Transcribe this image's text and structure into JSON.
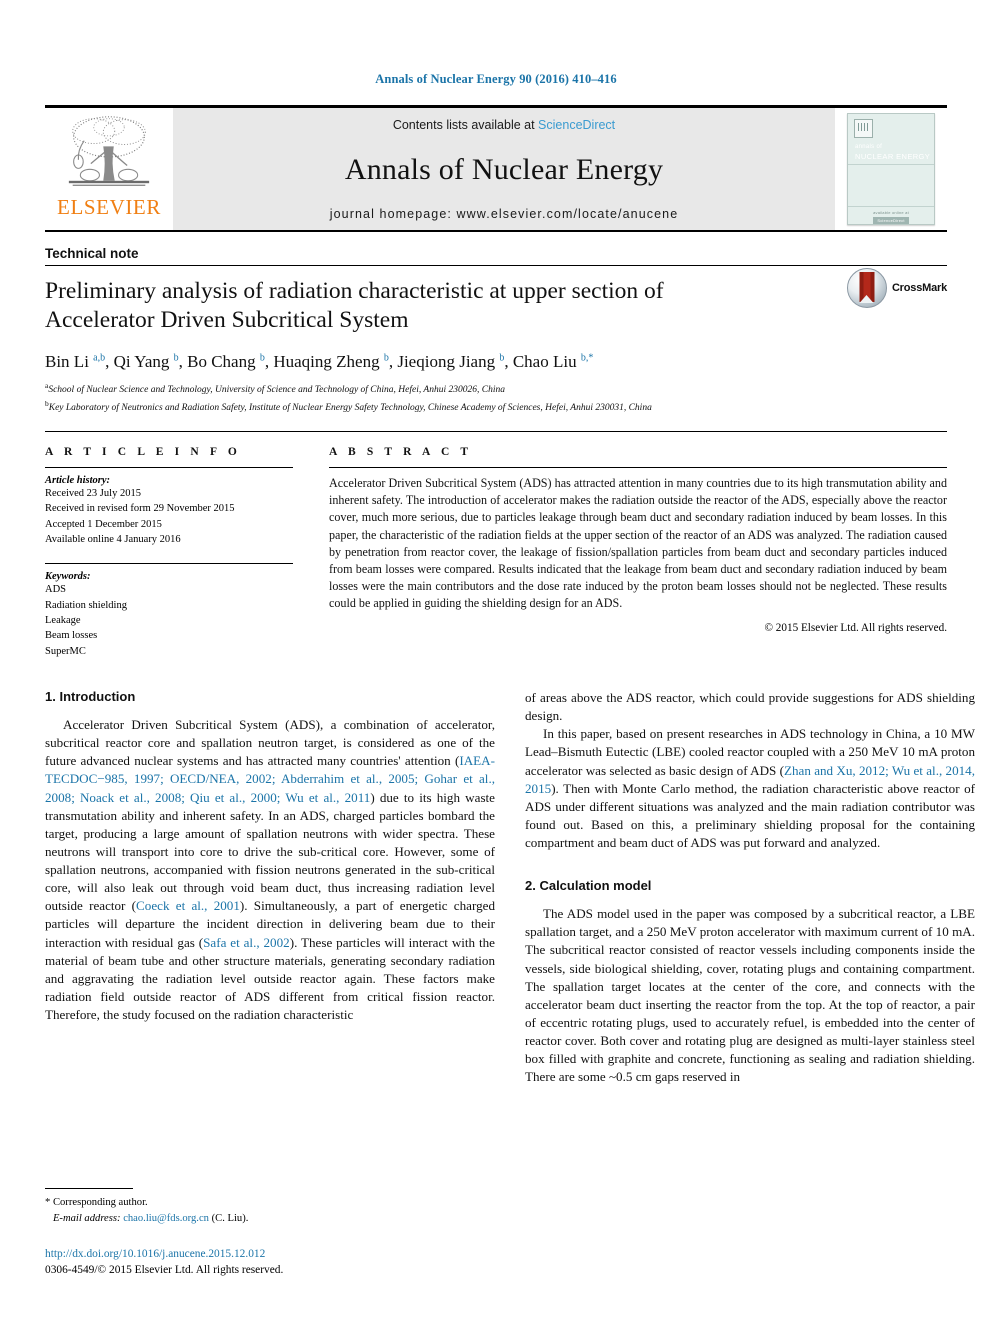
{
  "running_head": "Annals of Nuclear Energy 90 (2016) 410–416",
  "masthead": {
    "publisher": "ELSEVIER",
    "contents_prefix": "Contents lists available at ",
    "contents_link": "ScienceDirect",
    "journal_title": "Annals of Nuclear Energy",
    "homepage": "journal homepage: www.elsevier.com/locate/anucene",
    "cover": {
      "line1": "annals of",
      "line2": "NUCLEAR ENERGY",
      "footer_text": "available online at",
      "footer_badge": "ScienceDirect"
    }
  },
  "article": {
    "type": "Technical note",
    "title": "Preliminary analysis of radiation characteristic at upper section of Accelerator Driven Subcritical System",
    "crossmark_label": "CrossMark",
    "authors_html": "Bin Li <sup>a,b</sup>, Qi Yang <sup>b</sup>, Bo Chang <sup>b</sup>, Huaqing Zheng <sup>b</sup>, Jieqiong Jiang <sup>b</sup>, Chao Liu <sup class=\"star\">b,*</sup>",
    "affiliations": [
      "a School of Nuclear Science and Technology, University of Science and Technology of China, Hefei, Anhui 230026, China",
      "b Key Laboratory of Neutronics and Radiation Safety, Institute of Nuclear Energy Safety Technology, Chinese Academy of Sciences, Hefei, Anhui 230031, China"
    ]
  },
  "article_info": {
    "heading": "A R T I C L E   I N F O",
    "history_title": "Article history:",
    "history": [
      "Received 23 July 2015",
      "Received in revised form 29 November 2015",
      "Accepted 1 December 2015",
      "Available online 4 January 2016"
    ],
    "keywords_title": "Keywords:",
    "keywords": [
      "ADS",
      "Radiation shielding",
      "Leakage",
      "Beam losses",
      "SuperMC"
    ]
  },
  "abstract": {
    "heading": "A B S T R A C T",
    "text": "Accelerator Driven Subcritical System (ADS) has attracted attention in many countries due to its high transmutation ability and inherent safety. The introduction of accelerator makes the radiation outside the reactor of the ADS, especially above the reactor cover, much more serious, due to particles leakage through beam duct and secondary radiation induced by beam losses. In this paper, the characteristic of the radiation fields at the upper section of the reactor of an ADS was analyzed. The radiation caused by penetration from reactor cover, the leakage of fission/spallation particles from beam duct and secondary particles induced from beam losses were compared. Results indicated that the leakage from beam duct and secondary radiation induced by beam losses were the main contributors and the dose rate induced by the proton beam losses should not be neglected. These results could be applied in guiding the shielding design for an ADS.",
    "copyright": "© 2015 Elsevier Ltd. All rights reserved."
  },
  "sections": {
    "intro_heading": "1. Introduction",
    "intro_p1_a": "Accelerator Driven Subcritical System (ADS), a combination of accelerator, subcritical reactor core and spallation neutron target, is considered as one of the future advanced nuclear systems and has attracted many countries' attention (",
    "intro_p1_cite1": "IAEA-TECDOC−985, 1997; OECD/NEA, 2002; Abderrahim et al., 2005; Gohar et al., 2008; Noack et al., 2008; Qiu et al., 2000; Wu et al., 2011",
    "intro_p1_b": ") due to its high waste transmutation ability and inherent safety. In an ADS, charged particles bombard the target, producing a large amount of spallation neutrons with wider spectra. These neutrons will transport into core to drive the sub-critical core. However, some of spallation neutrons, accompanied with fission neutrons generated in the sub-critical core, will also leak out through void beam duct, thus increasing radiation level outside reactor (",
    "intro_p1_cite2": "Coeck et al., 2001",
    "intro_p1_c": "). Simultaneously, a part of energetic charged particles will departure the incident direction in delivering beam due to their interaction with residual gas (",
    "intro_p1_cite3": "Safa et al., 2002",
    "intro_p1_d": "). These particles will interact with the material of beam tube and other structure materials, generating secondary radiation and aggravating the radiation level outside reactor again. These factors make radiation field outside reactor of ADS different from critical fission reactor. Therefore, the study focused on the radiation characteristic of areas above the ADS reactor, which could provide suggestions for ADS shielding design.",
    "intro_p2_a": "In this paper, based on present researches in ADS technology in China, a 10 MW Lead–Bismuth Eutectic (LBE) cooled reactor coupled with a 250 MeV 10 mA proton accelerator was selected as basic design of ADS (",
    "intro_p2_cite": "Zhan and Xu, 2012; Wu et al., 2014, 2015",
    "intro_p2_b": "). Then with Monte Carlo method, the radiation characteristic above reactor of ADS under different situations was analyzed and the main radiation contributor was found out. Based on this, a preliminary shielding proposal for the containing compartment and beam duct of ADS was put forward and analyzed.",
    "calc_heading": "2. Calculation model",
    "calc_p1": "The ADS model used in the paper was composed by a subcritical reactor, a LBE spallation target, and a 250 MeV proton accelerator with maximum current of 10 mA. The subcritical reactor consisted of reactor vessels including components inside the vessels, side biological shielding, cover, rotating plugs and containing compartment. The spallation target locates at the center of the core, and connects with the accelerator beam duct inserting the reactor from the top. At the top of reactor, a pair of eccentric rotating plugs, used to accurately refuel, is embedded into the center of reactor cover. Both cover and rotating plug are designed as multi-layer stainless steel box filled with graphite and concrete, functioning as sealing and radiation shielding. There are some ~0.5 cm gaps reserved in"
  },
  "footnote": {
    "corresponding": "* Corresponding author.",
    "email_label": "E-mail address:",
    "email": "chao.liu@fds.org.cn",
    "email_suffix": "(C. Liu)."
  },
  "footer": {
    "doi": "http://dx.doi.org/10.1016/j.anucene.2015.12.012",
    "issn_line": "0306-4549/© 2015 Elsevier Ltd. All rights reserved."
  },
  "colors": {
    "link": "#1b74a8",
    "sciencedirect": "#3a9bd0",
    "elsevier_orange": "#f07f13",
    "band_gray": "#e8e8e8"
  }
}
